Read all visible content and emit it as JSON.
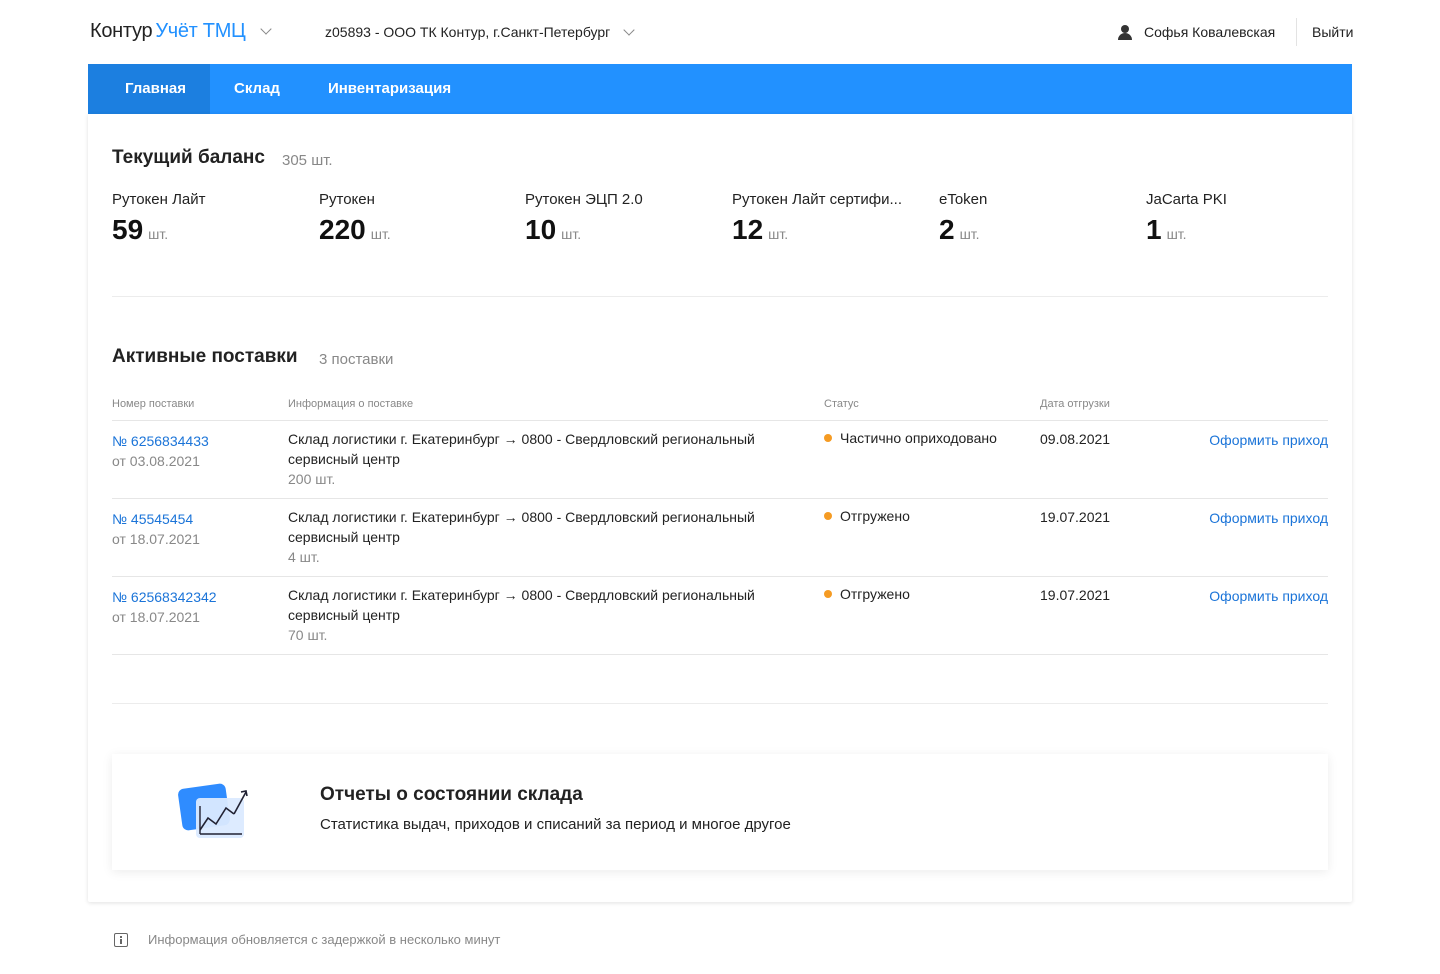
{
  "header": {
    "brand": "Контур",
    "product": "Учёт ТМЦ",
    "organization": "z05893 - ООО ТК Контур, г.Санкт-Петербург",
    "user_name": "Софья Ковалевская",
    "logout": "Выйти"
  },
  "nav": {
    "tabs": [
      {
        "label": "Главная",
        "active": true
      },
      {
        "label": "Склад",
        "active": false
      },
      {
        "label": "Инвентаризация",
        "active": false
      }
    ]
  },
  "balance": {
    "title": "Текущий баланс",
    "total": "305 шт.",
    "unit": "шт.",
    "items": [
      {
        "name": "Рутокен Лайт",
        "qty": "59"
      },
      {
        "name": "Рутокен",
        "qty": "220"
      },
      {
        "name": "Рутокен ЭЦП 2.0",
        "qty": "10"
      },
      {
        "name": "Рутокен Лайт сертифи...",
        "qty": "12"
      },
      {
        "name": "eToken",
        "qty": "2"
      },
      {
        "name": "JaCarta PKI",
        "qty": "1"
      }
    ]
  },
  "deliveries": {
    "title": "Активные поставки",
    "count": "3 поставки",
    "columns": {
      "number": "Номер поставки",
      "info": "Информация о поставке",
      "status": "Статус",
      "date": "Дата отгрузки"
    },
    "rows": [
      {
        "number": "№ 6256834433",
        "from": "от 03.08.2021",
        "info": "Склад логистики г. Екатеринбург → 0800 - Свердловский региональный сервисный центр",
        "qty": "200 шт.",
        "status": "Частично оприходовано",
        "ship_date": "09.08.2021",
        "action": "Оформить приход"
      },
      {
        "number": "№ 45545454",
        "from": "от 18.07.2021",
        "info": "Склад логистики г. Екатеринбург → 0800 - Свердловский региональный сервисный центр",
        "qty": "4 шт.",
        "status": "Отгружено",
        "ship_date": "19.07.2021",
        "action": "Оформить приход"
      },
      {
        "number": "№ 62568342342",
        "from": "от 18.07.2021",
        "info": "Склад логистики г. Екатеринбург → 0800 - Свердловский региональный сервисный центр",
        "qty": "70 шт.",
        "status": "Отгружено",
        "ship_date": "19.07.2021",
        "action": "Оформить приход"
      }
    ],
    "status_color": "#f59b23"
  },
  "report": {
    "title": "Отчеты о состоянии склада",
    "subtitle": "Статистика выдач, приходов и списаний за период и многое другое",
    "icon": "chart-icon"
  },
  "footer": {
    "note": "Информация обновляется с задержкой в несколько минут"
  },
  "colors": {
    "accent": "#2291ff",
    "nav_active": "#1c7fe0",
    "link": "#1b74d8"
  }
}
